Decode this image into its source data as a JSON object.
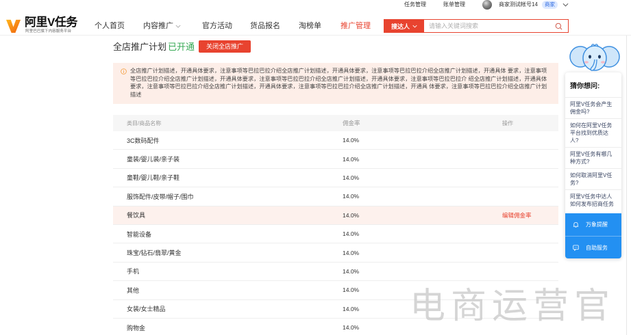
{
  "colors": {
    "brand_red": "#e8432f",
    "status_green": "#34a853",
    "notice_bg": "#fdeee8",
    "hover_row_bg": "#fdf1ed",
    "help_blue": "#2390f2",
    "watermark_gray": "#c4c4c4"
  },
  "topbar": {
    "task_management": "任务管理",
    "bill_management": "账单管理",
    "avatar_icon": "avatar-icon",
    "account_name": "商家测试帐号14",
    "role_badge": "商家",
    "dropdown_icon": "chevron-down-icon"
  },
  "header": {
    "logo_icon": "v-logo-icon",
    "logo_title": "阿里V任务",
    "logo_subtitle": "阿里巴巴旗下内容服务平台",
    "nav": [
      {
        "label": "个人首页"
      },
      {
        "label": "内容推广",
        "icon": "chevron-down-icon"
      },
      {
        "label": "官方活动"
      },
      {
        "label": "货品报名"
      },
      {
        "label": "淘榜单"
      },
      {
        "label": "推广管理",
        "active": true
      }
    ],
    "search": {
      "type_label": "搜达人",
      "type_icon": "chevron-down-icon",
      "placeholder": "请输入关键词搜索",
      "icon": "search-icon"
    }
  },
  "plan": {
    "title": "全店推广计划",
    "status": "已开通",
    "close_button": "关闭全店推广",
    "notice_icon": "info-icon",
    "notice": "全店推广计划描述，开通具体要求，注意事项等巴拉巴拉介绍全店推广计划描述，开通具体要求，注意事项等巴拉巴拉介绍全店推广计划描述，开通具体 要求，注意事项等巴拉巴拉介绍全店推广计划描述，开通具体要求，注意事项等巴拉巴拉介绍全店推广计划描述，开通具体要求，注意事项等巴拉巴拉介 绍全店推广计划描述，开通具体要求，注意事项等巴拉巴拉介绍全店推广计划描述，开通具体要求，注意事项等巴拉巴拉介绍全店推广计划描述，开通具 体要求，注意事项等巴拉巴拉介绍全店推广计划描述"
  },
  "table": {
    "columns": {
      "name": "类目/商品名称",
      "rate": "佣金率",
      "action": "操作"
    },
    "rows": [
      {
        "name": "3C数码配件",
        "rate": "14.0%"
      },
      {
        "name": "童装/婴儿装/亲子装",
        "rate": "14.0%"
      },
      {
        "name": "童鞋/婴儿鞋/亲子鞋",
        "rate": "14.0%"
      },
      {
        "name": "服饰配件/皮带/帽子/围巾",
        "rate": "14.0%"
      },
      {
        "name": "餐饮具",
        "rate": "14.0%",
        "action": "编辑佣金率",
        "hovered": true
      },
      {
        "name": "智能设备",
        "rate": "14.0%"
      },
      {
        "name": "珠宝/钻石/翡翠/黄金",
        "rate": "14.0%"
      },
      {
        "name": "手机",
        "rate": "14.0%"
      },
      {
        "name": "其他",
        "rate": "14.0%"
      },
      {
        "name": "女装/女士精品",
        "rate": "14.0%"
      },
      {
        "name": "购物金",
        "rate": "14.0%"
      }
    ]
  },
  "help": {
    "mascot_icon": "elephant-mascot-icon",
    "heading": "猜你想问:",
    "questions": [
      "阿里V任务会产生佣金吗?",
      "如何在阿里V任务平台找到优质达人?",
      "阿里V任务有哪几种方式?",
      "如何取消阿里V任务?",
      "阿里V任务中达人如何发布招商任务"
    ],
    "buttons": [
      {
        "label": "万象提醒",
        "icon": "bell-icon"
      },
      {
        "label": "自助服务",
        "icon": "chat-icon"
      }
    ]
  },
  "watermark": "电商运营官"
}
